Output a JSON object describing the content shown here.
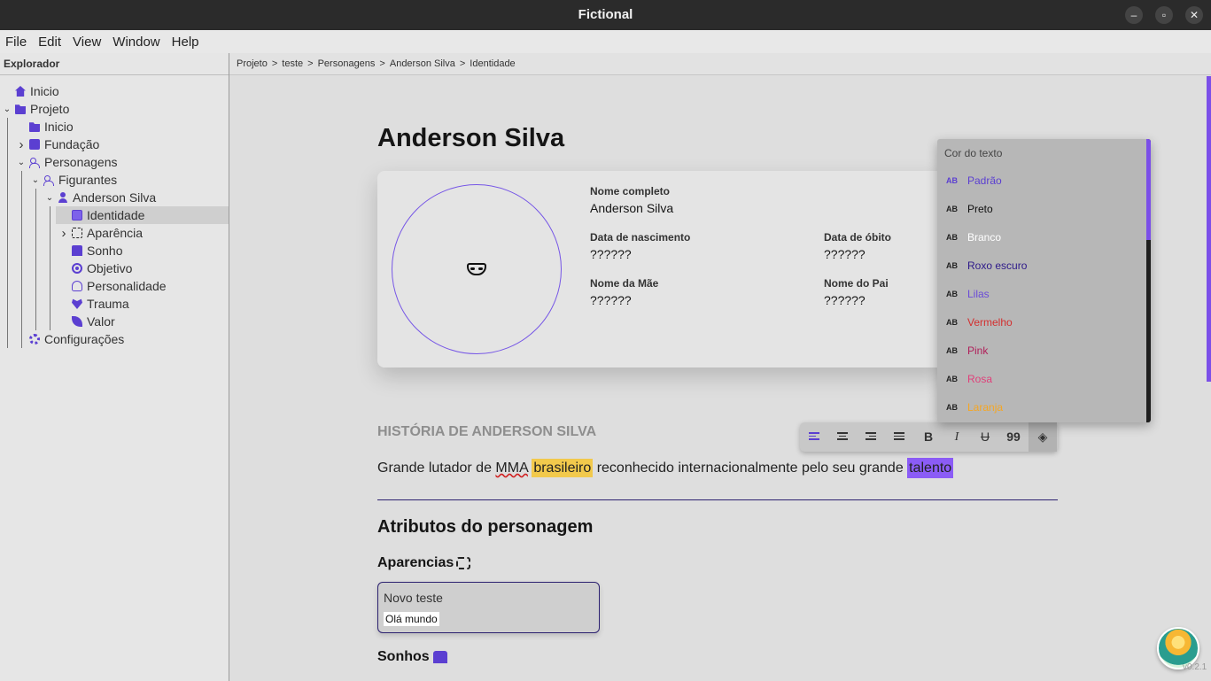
{
  "window": {
    "title": "Fictional"
  },
  "menu": [
    "File",
    "Edit",
    "View",
    "Window",
    "Help"
  ],
  "sidebar": {
    "heading": "Explorador",
    "tree": [
      {
        "label": "Inicio",
        "icon": "home-icon",
        "depth": 0,
        "chevron": ""
      },
      {
        "label": "Projeto",
        "icon": "folder-icon",
        "depth": 0,
        "chevron": "v"
      },
      {
        "label": "Inicio",
        "icon": "folder-icon",
        "depth": 1,
        "chevron": ""
      },
      {
        "label": "Fundação",
        "icon": "book-icon",
        "depth": 1,
        "chevron": ">"
      },
      {
        "label": "Personagens",
        "icon": "people-icon",
        "depth": 1,
        "chevron": "v"
      },
      {
        "label": "Figurantes",
        "icon": "people-icon",
        "depth": 2,
        "chevron": "v"
      },
      {
        "label": "Anderson Silva",
        "icon": "user-icon",
        "depth": 3,
        "chevron": "v"
      },
      {
        "label": "Identidade",
        "icon": "id-card-icon",
        "depth": 4,
        "chevron": "",
        "selected": true
      },
      {
        "label": "Aparência",
        "icon": "face-scan-icon",
        "depth": 4,
        "chevron": ">"
      },
      {
        "label": "Sonho",
        "icon": "bed-icon",
        "depth": 4,
        "chevron": ""
      },
      {
        "label": "Objetivo",
        "icon": "target-icon",
        "depth": 4,
        "chevron": ""
      },
      {
        "label": "Personalidade",
        "icon": "fingerprint-icon",
        "depth": 4,
        "chevron": ""
      },
      {
        "label": "Trauma",
        "icon": "heart-icon",
        "depth": 4,
        "chevron": ""
      },
      {
        "label": "Valor",
        "icon": "leaf-icon",
        "depth": 4,
        "chevron": ""
      },
      {
        "label": "Configurações",
        "icon": "gear-icon",
        "depth": 1,
        "chevron": ""
      }
    ]
  },
  "breadcrumb": [
    "Projeto",
    ">",
    "teste",
    ">",
    "Personagens",
    ">",
    "Anderson Silva",
    ">",
    "Identidade"
  ],
  "character": {
    "name": "Anderson Silva",
    "fields": {
      "full_name_label": "Nome completo",
      "full_name": "Anderson Silva",
      "birth_label": "Data de nascimento",
      "birth": "??????",
      "death_label": "Data de óbito",
      "death": "??????",
      "mother_label": "Nome da Mãe",
      "mother": "??????",
      "father_label": "Nome do Pai",
      "father": "??????"
    }
  },
  "history": {
    "heading": "HISTÓRIA DE ANDERSON SILVA",
    "p1": "Grande lutador de ",
    "p2": "MMA",
    "p3": " ",
    "p4": "brasileiro",
    "p5": " reconhecido internacionalmente pelo seu grande ",
    "p6": "talento"
  },
  "attributes": {
    "heading": "Atributos do personagem",
    "aparencias": "Aparencias",
    "sonhos": "Sonhos",
    "card_title": "Novo teste",
    "card_value": "Olá mundo"
  },
  "toolbar": {
    "bold": "B",
    "italic": "I",
    "strike": "U",
    "quote": "99"
  },
  "color_menu": {
    "heading": "Cor do texto",
    "items": [
      {
        "label": "Padrão",
        "color": "#5b3fd1"
      },
      {
        "label": "Preto",
        "color": "#111111"
      },
      {
        "label": "Branco",
        "color": "#ffffff"
      },
      {
        "label": "Roxo escuro",
        "color": "#2e1a8a"
      },
      {
        "label": "Lilas",
        "color": "#6a4bd8"
      },
      {
        "label": "Vermelho",
        "color": "#d32f2f"
      },
      {
        "label": "Pink",
        "color": "#b0205a"
      },
      {
        "label": "Rosa",
        "color": "#e0407a"
      },
      {
        "label": "Laranja",
        "color": "#f5a623"
      }
    ]
  },
  "version": "v0.2.1"
}
